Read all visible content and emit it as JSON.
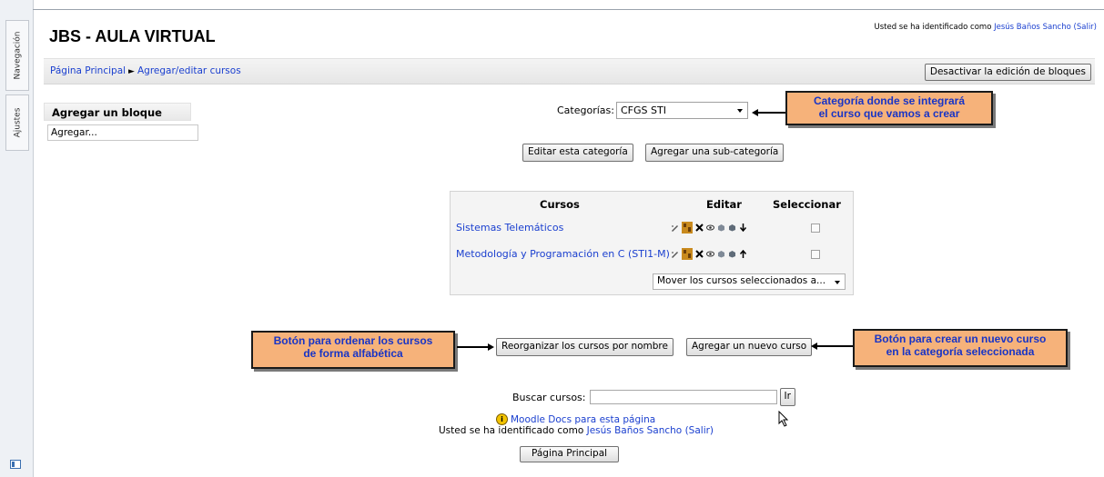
{
  "dock": {
    "tabs": [
      "Navegación",
      "Ajustes"
    ]
  },
  "header": {
    "site_title": "JBS - AULA VIRTUAL",
    "login_prefix": "Usted se ha identificado como ",
    "user_name": "Jesús Baños Sancho",
    "logout": "(Salir)"
  },
  "navbar": {
    "breadcrumb_home": "Página Principal",
    "breadcrumb_separator": "►",
    "breadcrumb_current": "Agregar/editar cursos",
    "stop_editing_button": "Desactivar la edición de bloques"
  },
  "add_block": {
    "title": "Agregar un bloque",
    "select_value": "Agregar..."
  },
  "category": {
    "label": "Categorías:",
    "selected": "CFGS STI",
    "edit_button": "Editar esta categoría",
    "add_subcategory_button": "Agregar una sub-categoría"
  },
  "courses_table": {
    "headers": [
      "Cursos",
      "Editar",
      "Seleccionar"
    ],
    "rows": [
      {
        "name": "Sistemas Telemáticos",
        "move_arrow": "down"
      },
      {
        "name": "Metodología y Programación en C (STI1-M)",
        "move_arrow": "up"
      }
    ],
    "move_select": "Mover los cursos seleccionados a..."
  },
  "callouts": {
    "category": [
      "Categoría donde se integrará",
      "el curso que vamos a crear"
    ],
    "sort": [
      "Botón para ordenar los cursos",
      "de forma alfabética"
    ],
    "new_course": [
      "Botón para crear un nuevo curso",
      "en la categoría seleccionada"
    ]
  },
  "actions": {
    "reorganize_button": "Reorganizar los cursos por nombre",
    "new_course_button": "Agregar un nuevo curso"
  },
  "search": {
    "label": "Buscar cursos:",
    "value": "",
    "go_button": "Ir"
  },
  "footer": {
    "docs_link": "Moodle Docs para esta página",
    "login_prefix": "Usted se ha identificado como ",
    "user_name": "Jesús Baños Sancho",
    "logout": "(Salir)",
    "home_button": "Página Principal"
  },
  "colors": {
    "link": "#1a3fcf",
    "callout_bg": "#f6b27a",
    "callout_text": "#1834c6"
  }
}
